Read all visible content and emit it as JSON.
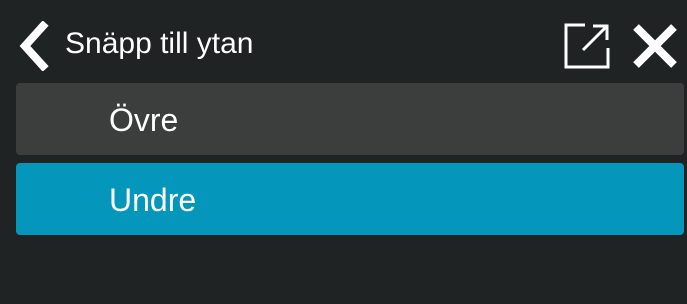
{
  "header": {
    "title": "Snäpp till ytan",
    "back_icon": "chevron-left-icon",
    "popout_icon": "external-window-icon",
    "close_icon": "close-icon"
  },
  "options": [
    {
      "label": "Övre",
      "selected": false
    },
    {
      "label": "Undre",
      "selected": true
    }
  ],
  "colors": {
    "background": "#1f2323",
    "option_default": "#3c3e3e",
    "option_selected": "#0596bc",
    "text": "#ffffff"
  }
}
